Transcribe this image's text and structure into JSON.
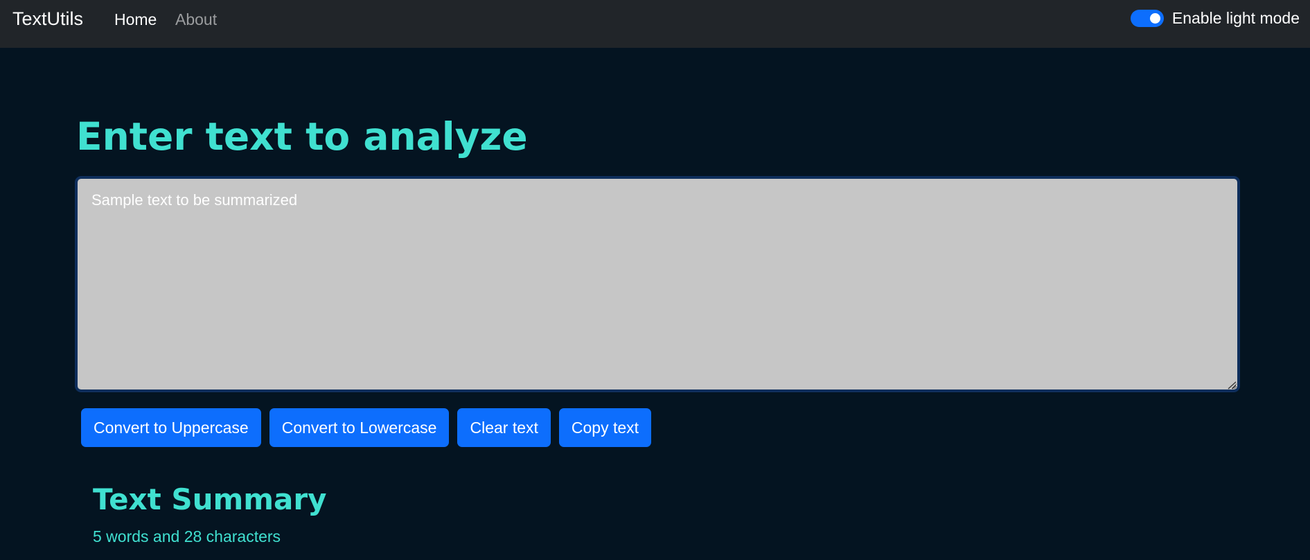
{
  "navbar": {
    "brand": "TextUtils",
    "links": {
      "home": "Home",
      "about": "About"
    },
    "mode_toggle": {
      "label": "Enable light mode",
      "enabled": true
    }
  },
  "main": {
    "heading": "Enter text to analyze",
    "textarea": {
      "value": "Sample text to be summarized"
    },
    "buttons": {
      "uppercase": "Convert to Uppercase",
      "lowercase": "Convert to Lowercase",
      "clear": "Clear text",
      "copy": "Copy text"
    }
  },
  "summary": {
    "title": "Text Summary",
    "stats": "5 words and 28 characters"
  },
  "colors": {
    "navbar_bg": "#212529",
    "page_bg": "#041421",
    "accent": "#40e0d0",
    "button": "#0d6efd",
    "textarea_bg": "#c6c6c6"
  }
}
